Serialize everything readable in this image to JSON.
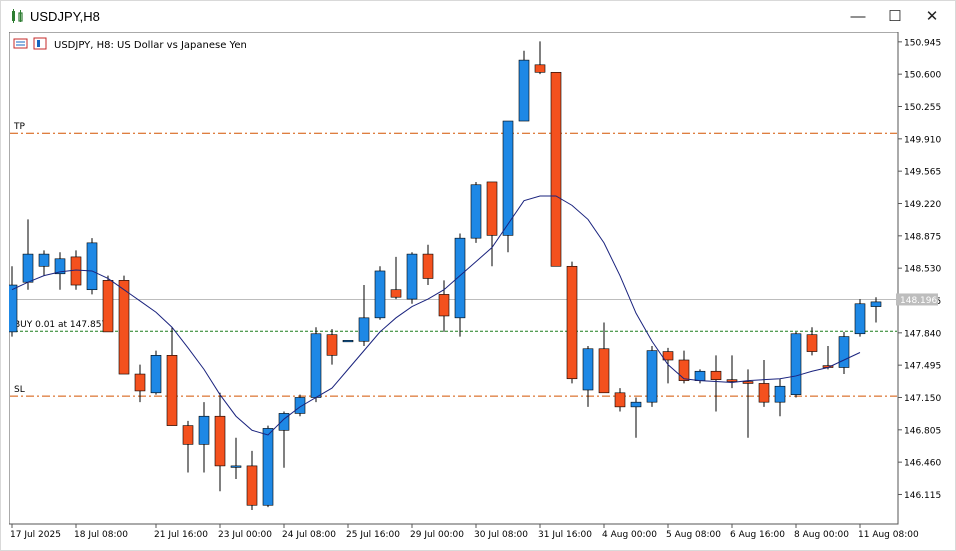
{
  "window": {
    "title": "USDJPY,H8"
  },
  "chart_data": {
    "type": "candlestick",
    "title": "USDJPY, H8:  US Dollar vs Japanese Yen",
    "ylim": [
      145.8,
      151.05
    ],
    "y_ticks": [
      "150.945",
      "150.600",
      "150.255",
      "149.910",
      "149.565",
      "149.220",
      "148.875",
      "148.530",
      "148.185",
      "147.840",
      "147.495",
      "147.150",
      "146.805",
      "146.460",
      "146.115"
    ],
    "x_labels": [
      {
        "i": 0,
        "label": "17 Jul 2025"
      },
      {
        "i": 4,
        "label": "18 Jul 08:00"
      },
      {
        "i": 9,
        "label": "21 Jul 16:00"
      },
      {
        "i": 13,
        "label": "23 Jul 00:00"
      },
      {
        "i": 17,
        "label": "24 Jul 08:00"
      },
      {
        "i": 21,
        "label": "25 Jul 16:00"
      },
      {
        "i": 25,
        "label": "29 Jul 00:00"
      },
      {
        "i": 29,
        "label": "30 Jul 08:00"
      },
      {
        "i": 33,
        "label": "31 Jul 16:00"
      },
      {
        "i": 37,
        "label": "4 Aug 00:00"
      },
      {
        "i": 41,
        "label": "5 Aug 08:00"
      },
      {
        "i": 45,
        "label": "6 Aug 16:00"
      },
      {
        "i": 49,
        "label": "8 Aug 00:00"
      },
      {
        "i": 53,
        "label": "11 Aug 08:00"
      }
    ],
    "candles": [
      {
        "o": 147.85,
        "h": 148.55,
        "l": 147.8,
        "c": 148.35
      },
      {
        "o": 148.38,
        "h": 149.05,
        "l": 148.3,
        "c": 148.68
      },
      {
        "o": 148.55,
        "h": 148.72,
        "l": 148.45,
        "c": 148.68
      },
      {
        "o": 148.47,
        "h": 148.7,
        "l": 148.3,
        "c": 148.63
      },
      {
        "o": 148.65,
        "h": 148.72,
        "l": 148.3,
        "c": 148.35
      },
      {
        "o": 148.3,
        "h": 148.85,
        "l": 148.25,
        "c": 148.8
      },
      {
        "o": 148.4,
        "h": 148.45,
        "l": 147.95,
        "c": 147.85
      },
      {
        "o": 148.4,
        "h": 148.45,
        "l": 147.4,
        "c": 147.4
      },
      {
        "o": 147.4,
        "h": 147.5,
        "l": 147.1,
        "c": 147.22
      },
      {
        "o": 147.2,
        "h": 147.65,
        "l": 147.18,
        "c": 147.6
      },
      {
        "o": 147.6,
        "h": 147.9,
        "l": 146.85,
        "c": 146.85
      },
      {
        "o": 146.85,
        "h": 146.9,
        "l": 146.35,
        "c": 146.65
      },
      {
        "o": 146.65,
        "h": 147.1,
        "l": 146.35,
        "c": 146.95
      },
      {
        "o": 146.95,
        "h": 147.2,
        "l": 146.15,
        "c": 146.42
      },
      {
        "o": 146.42,
        "h": 146.72,
        "l": 146.28,
        "c": 146.42
      },
      {
        "o": 146.42,
        "h": 146.58,
        "l": 145.95,
        "c": 146.0
      },
      {
        "o": 146.0,
        "h": 146.85,
        "l": 145.98,
        "c": 146.82
      },
      {
        "o": 146.8,
        "h": 147.0,
        "l": 146.4,
        "c": 146.98
      },
      {
        "o": 146.98,
        "h": 147.18,
        "l": 146.95,
        "c": 147.15
      },
      {
        "o": 147.15,
        "h": 147.9,
        "l": 147.1,
        "c": 147.83
      },
      {
        "o": 147.82,
        "h": 147.88,
        "l": 147.5,
        "c": 147.6
      },
      {
        "o": 147.75,
        "h": 147.75,
        "l": 147.75,
        "c": 147.76
      },
      {
        "o": 147.75,
        "h": 148.35,
        "l": 147.7,
        "c": 148.0
      },
      {
        "o": 148.0,
        "h": 148.55,
        "l": 147.98,
        "c": 148.5
      },
      {
        "o": 148.3,
        "h": 148.65,
        "l": 148.2,
        "c": 148.22
      },
      {
        "o": 148.2,
        "h": 148.7,
        "l": 148.15,
        "c": 148.68
      },
      {
        "o": 148.68,
        "h": 148.78,
        "l": 148.35,
        "c": 148.42
      },
      {
        "o": 148.25,
        "h": 148.4,
        "l": 147.85,
        "c": 148.02
      },
      {
        "o": 148.0,
        "h": 148.9,
        "l": 147.8,
        "c": 148.85
      },
      {
        "o": 148.85,
        "h": 149.45,
        "l": 148.8,
        "c": 149.42
      },
      {
        "o": 149.45,
        "h": 149.45,
        "l": 148.55,
        "c": 148.88
      },
      {
        "o": 148.88,
        "h": 150.1,
        "l": 148.7,
        "c": 150.1
      },
      {
        "o": 150.1,
        "h": 150.85,
        "l": 150.1,
        "c": 150.75
      },
      {
        "o": 150.7,
        "h": 150.95,
        "l": 150.6,
        "c": 150.62
      },
      {
        "o": 150.62,
        "h": 150.62,
        "l": 148.55,
        "c": 148.55
      },
      {
        "o": 148.55,
        "h": 148.6,
        "l": 147.3,
        "c": 147.35
      },
      {
        "o": 147.23,
        "h": 147.7,
        "l": 147.05,
        "c": 147.67
      },
      {
        "o": 147.67,
        "h": 147.95,
        "l": 147.2,
        "c": 147.2
      },
      {
        "o": 147.2,
        "h": 147.25,
        "l": 147.0,
        "c": 147.05
      },
      {
        "o": 147.05,
        "h": 147.15,
        "l": 146.72,
        "c": 147.1
      },
      {
        "o": 147.1,
        "h": 147.7,
        "l": 147.05,
        "c": 147.65
      },
      {
        "o": 147.64,
        "h": 147.68,
        "l": 147.3,
        "c": 147.55
      },
      {
        "o": 147.55,
        "h": 147.65,
        "l": 147.3,
        "c": 147.33
      },
      {
        "o": 147.33,
        "h": 147.45,
        "l": 147.3,
        "c": 147.43
      },
      {
        "o": 147.43,
        "h": 147.6,
        "l": 147.0,
        "c": 147.34
      },
      {
        "o": 147.34,
        "h": 147.6,
        "l": 147.25,
        "c": 147.32
      },
      {
        "o": 147.32,
        "h": 147.45,
        "l": 146.72,
        "c": 147.3
      },
      {
        "o": 147.3,
        "h": 147.55,
        "l": 147.05,
        "c": 147.1
      },
      {
        "o": 147.1,
        "h": 147.35,
        "l": 146.95,
        "c": 147.27
      },
      {
        "o": 147.18,
        "h": 147.85,
        "l": 147.15,
        "c": 147.83
      },
      {
        "o": 147.82,
        "h": 147.9,
        "l": 147.6,
        "c": 147.64
      },
      {
        "o": 147.49,
        "h": 147.7,
        "l": 147.45,
        "c": 147.47
      },
      {
        "o": 147.47,
        "h": 147.85,
        "l": 147.4,
        "c": 147.8
      },
      {
        "o": 147.83,
        "h": 148.2,
        "l": 147.8,
        "c": 148.15
      },
      {
        "o": 148.12,
        "h": 148.22,
        "l": 147.95,
        "c": 148.17
      }
    ],
    "moving_average": [
      148.3,
      148.38,
      148.45,
      148.49,
      148.51,
      148.5,
      148.42,
      148.3,
      148.18,
      148.06,
      147.9,
      147.68,
      147.45,
      147.18,
      146.95,
      146.8,
      146.75,
      146.92,
      147.05,
      147.15,
      147.25,
      147.45,
      147.65,
      147.85,
      148.0,
      148.12,
      148.2,
      148.3,
      148.45,
      148.6,
      148.75,
      149.0,
      149.25,
      149.3,
      149.3,
      149.2,
      149.05,
      148.8,
      148.45,
      148.05,
      147.75,
      147.5,
      147.35,
      147.33,
      147.32,
      147.31,
      147.33,
      147.34,
      147.35,
      147.38,
      147.43,
      147.47,
      147.55,
      147.63
    ],
    "series": [
      {
        "name": "TP",
        "y": 149.97
      },
      {
        "name": "BUY 0.01 at 147.857",
        "y": 147.857
      },
      {
        "name": "SL",
        "y": 147.165
      }
    ],
    "current_price": {
      "value": 148.196,
      "label": "148.196"
    },
    "colors": {
      "bull": "#1e88e5",
      "bear": "#f4511e",
      "ma": "#1a237e",
      "tp_sl": "#d35400",
      "buy": "#1b7d1b",
      "grid": "#c9c9c9",
      "price_tag": "#bdbdbd"
    }
  }
}
